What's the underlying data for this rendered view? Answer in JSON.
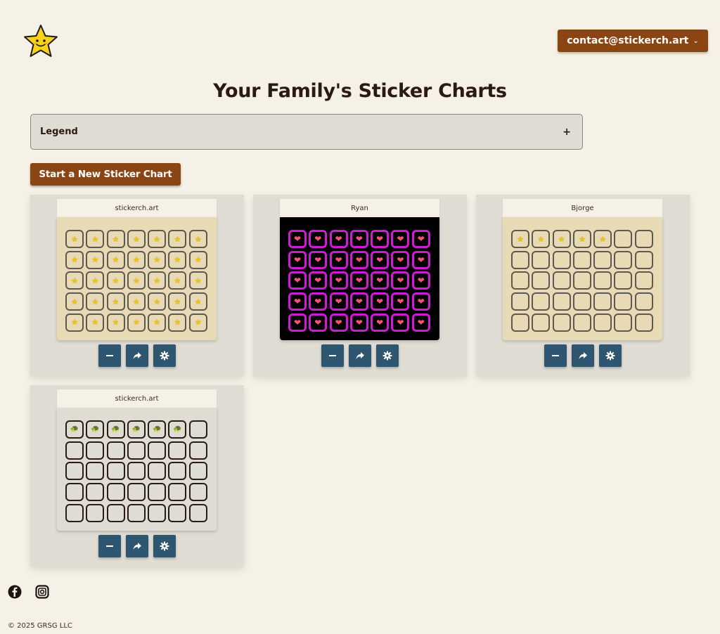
{
  "header": {
    "logo_icon": "smiling-star-icon",
    "account_email": "contact@stickerch.art",
    "account_chevron": "⌄"
  },
  "page": {
    "title": "Your Family's Sticker Charts"
  },
  "legend": {
    "label": "Legend",
    "expand_symbol": "+"
  },
  "new_chart_button": {
    "label": "Start a New Sticker Chart"
  },
  "charts": [
    {
      "title": "stickerch.art",
      "theme": "yellow",
      "sticker": "★",
      "sticker_name": "star-sticker-icon",
      "rows": 5,
      "cols": 7,
      "filled": 35
    },
    {
      "title": "Ryan",
      "theme": "black",
      "sticker": "❤",
      "sticker_name": "heart-sticker-icon",
      "rows": 5,
      "cols": 7,
      "filled": 35
    },
    {
      "title": "Bjorge",
      "theme": "yellow",
      "sticker": "★",
      "sticker_name": "star-sticker-icon",
      "rows": 5,
      "cols": 7,
      "filled": 5
    },
    {
      "title": "stickerch.art",
      "theme": "grey",
      "sticker": "🐢",
      "sticker_name": "turtle-sticker-icon",
      "rows": 5,
      "cols": 7,
      "filled": 6
    }
  ],
  "chart_actions": [
    {
      "name": "remove-sticker-button",
      "icon": "minus-icon"
    },
    {
      "name": "share-chart-button",
      "icon": "share-arrow-icon"
    },
    {
      "name": "chart-settings-button",
      "icon": "gear-icon"
    }
  ],
  "social": [
    {
      "name": "facebook-link",
      "icon": "facebook-icon"
    },
    {
      "name": "instagram-link",
      "icon": "instagram-icon"
    }
  ],
  "footer": {
    "copyright": "© 2025 GRSG LLC"
  },
  "colors": {
    "brand": "#8a4513",
    "action": "#2f5670",
    "background": "#f6f1e6",
    "card": "#dedcd3",
    "yellow_board": "#e7dab4",
    "neon_border": "#d11ad6"
  }
}
